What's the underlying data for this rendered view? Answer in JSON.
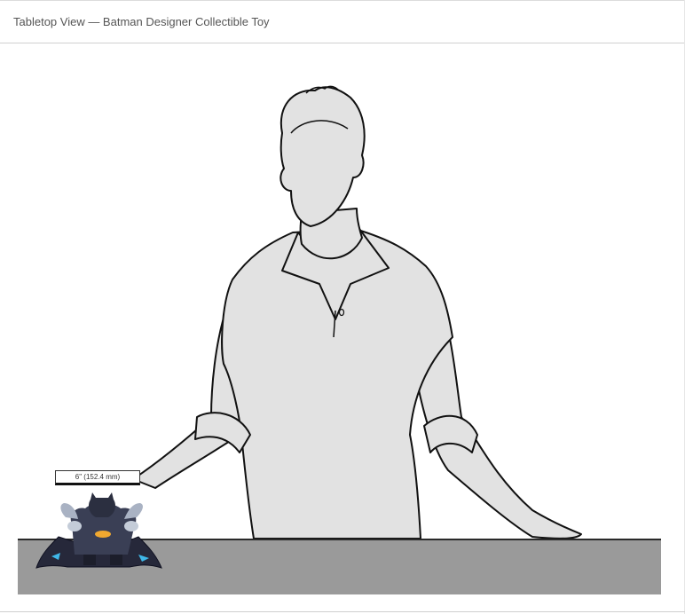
{
  "header": {
    "title": "Tabletop View — Batman Designer Collectible Toy"
  },
  "scene": {
    "dimension_label": "6\" (152.4 mm)",
    "figure_icon": "person-silhouette-icon",
    "product_icon": "batman-figure-icon",
    "colors": {
      "table": "#9a9a9a",
      "silhouette_fill": "#e2e2e2",
      "outline": "#111111"
    }
  }
}
